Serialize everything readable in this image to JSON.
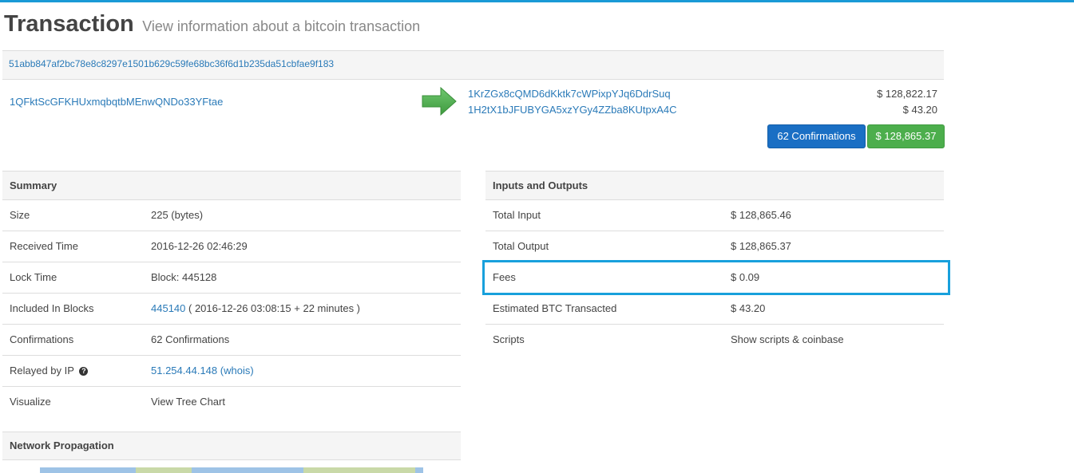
{
  "header": {
    "title": "Transaction",
    "subtitle": "View information about a bitcoin transaction"
  },
  "transaction": {
    "hash": "51abb847af2bc78e8c8297e1501b629c59fe68bc36f6d1b235da51cbfae9f183",
    "input_address": "1QFktScGFKHUxmqbqtbMEnwQNDo33YFtae",
    "outputs": [
      {
        "address": "1KrZGx8cQMD6dKktk7cWPixpYJq6DdrSuq",
        "amount": "$ 128,822.17"
      },
      {
        "address": "1H2tX1bJFUBYGA5xzYGy4ZZba8KUtpxA4C",
        "amount": "$ 43.20"
      }
    ],
    "confirmations_button": "62 Confirmations",
    "total_button": "$ 128,865.37"
  },
  "summary": {
    "heading": "Summary",
    "rows": {
      "size": {
        "label": "Size",
        "value": "225 (bytes)"
      },
      "received": {
        "label": "Received Time",
        "value": "2016-12-26 02:46:29"
      },
      "lock": {
        "label": "Lock Time",
        "value": "Block: 445128"
      },
      "included": {
        "label": "Included In Blocks",
        "block_link": "445140",
        "detail": " ( 2016-12-26 03:08:15 + 22 minutes )"
      },
      "confirmations": {
        "label": "Confirmations",
        "value": "62 Confirmations"
      },
      "relayed": {
        "label": "Relayed by IP",
        "help": "?",
        "ip_link": "51.254.44.148",
        "whois_link": "(whois)"
      },
      "visualize": {
        "label": "Visualize",
        "link": "View Tree Chart"
      }
    }
  },
  "io": {
    "heading": "Inputs and Outputs",
    "rows": {
      "total_input": {
        "label": "Total Input",
        "value": "$ 128,865.46"
      },
      "total_output": {
        "label": "Total Output",
        "value": "$ 128,865.37"
      },
      "fees": {
        "label": "Fees",
        "value": "$ 0.09"
      },
      "estimated": {
        "label": "Estimated BTC Transacted",
        "value": "$ 43.20"
      },
      "scripts": {
        "label": "Scripts",
        "link": "Show scripts & coinbase"
      }
    }
  },
  "network": {
    "heading": "Network Propagation"
  },
  "colors": {
    "accent_blue": "#1a9ad6",
    "link": "#2a7ab8",
    "confirm_button": "#1a6fc4",
    "amount_button": "#4cae4c",
    "highlight": "#18a0dc",
    "arrow": "#4cae4c"
  },
  "icons": {
    "arrow": "right-arrow-icon",
    "help": "question-circle-icon"
  }
}
